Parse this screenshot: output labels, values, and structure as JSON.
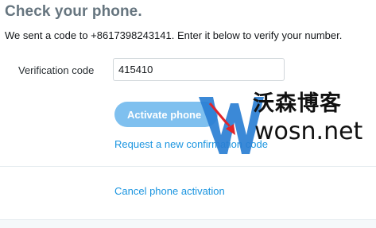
{
  "page": {
    "title": "Check your phone.",
    "subtitle": "We sent a code to +8617398243141. Enter it below to verify your number."
  },
  "form": {
    "code_label": "Verification code",
    "code_value": "415410",
    "activate_label": "Activate phone",
    "resend_label": "Request a new confirmation code",
    "cancel_label": "Cancel phone activation"
  },
  "watermark": {
    "brand_cn": "沃森博客",
    "url": "wosn.net"
  },
  "colors": {
    "title": "#66757f",
    "link": "#1b95e0",
    "button": "#7fc0ef",
    "watermark_w": "#2a7fd4",
    "watermark_arrow": "#e0242a"
  }
}
